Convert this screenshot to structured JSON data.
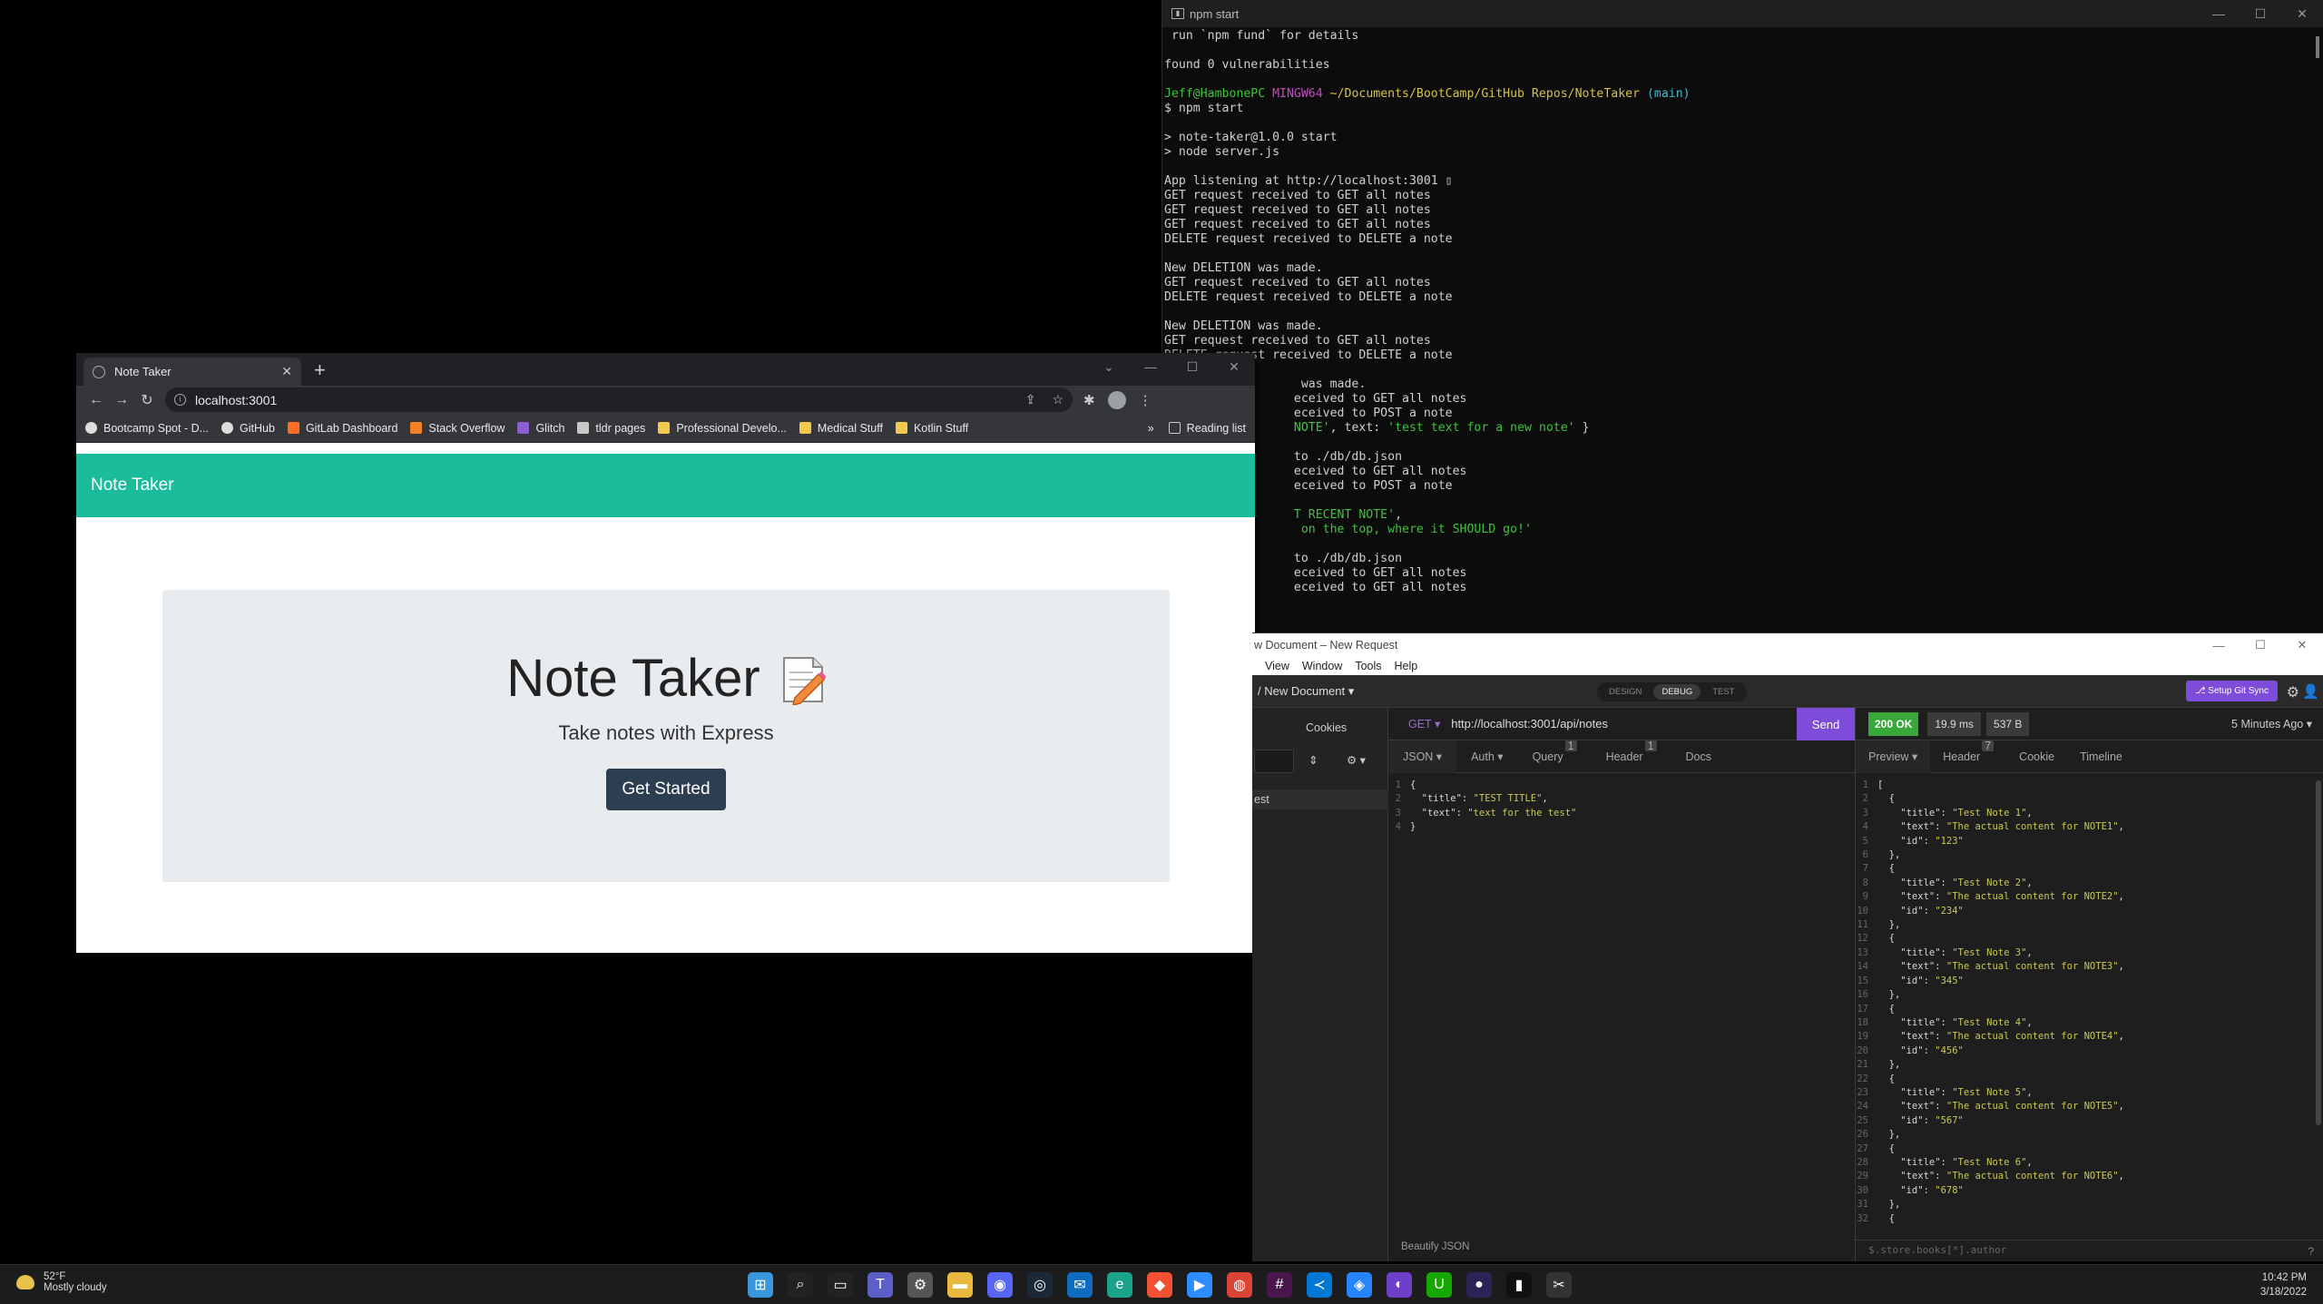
{
  "terminal": {
    "title": "npm start",
    "lines": [
      {
        "t": " run `npm fund` for details"
      },
      {
        "t": ""
      },
      {
        "t": "found 0 vulnerabilities"
      },
      {
        "t": ""
      },
      {
        "parts": [
          {
            "t": "Jeff@HambonePC ",
            "c": "g"
          },
          {
            "t": "MINGW64 ",
            "c": "m"
          },
          {
            "t": "~/Documents/BootCamp/GitHub Repos/NoteTaker ",
            "c": "y"
          },
          {
            "t": "(main)",
            "c": "c"
          }
        ]
      },
      {
        "t": "$ npm start"
      },
      {
        "t": ""
      },
      {
        "t": "> note-taker@1.0.0 start"
      },
      {
        "t": "> node server.js"
      },
      {
        "t": ""
      },
      {
        "t": "App listening at http://localhost:3001 ▯"
      },
      {
        "t": "GET request received to GET all notes"
      },
      {
        "t": "GET request received to GET all notes"
      },
      {
        "t": "GET request received to GET all notes"
      },
      {
        "t": "DELETE request received to DELETE a note"
      },
      {
        "t": ""
      },
      {
        "t": "New DELETION was made."
      },
      {
        "t": "GET request received to GET all notes"
      },
      {
        "t": "DELETE request received to DELETE a note"
      },
      {
        "t": ""
      },
      {
        "t": "New DELETION was made."
      },
      {
        "t": "GET request received to GET all notes"
      },
      {
        "t": "DELETE request received to DELETE a note"
      },
      {
        "t": ""
      },
      {
        "t": "                   was made."
      },
      {
        "t": "                  eceived to GET all notes"
      },
      {
        "t": "                  eceived to POST a note"
      },
      {
        "parts": [
          {
            "t": "                  NOTE'",
            "c": "g"
          },
          {
            "t": ", text: "
          },
          {
            "t": "'test text for a new note'",
            "c": "g"
          },
          {
            "t": " }"
          }
        ]
      },
      {
        "t": ""
      },
      {
        "t": "                  to ./db/db.json"
      },
      {
        "t": "                  eceived to GET all notes"
      },
      {
        "t": "                  eceived to POST a note"
      },
      {
        "t": ""
      },
      {
        "parts": [
          {
            "t": "                  T RECENT NOTE'",
            "c": "g"
          },
          {
            "t": ","
          }
        ]
      },
      {
        "parts": [
          {
            "t": "                   on the top, where it SHOULD go!'",
            "c": "g"
          }
        ]
      },
      {
        "t": ""
      },
      {
        "t": "                  to ./db/db.json"
      },
      {
        "t": "                  eceived to GET all notes"
      },
      {
        "t": "                  eceived to GET all notes"
      }
    ]
  },
  "chrome": {
    "tab_title": "Note Taker",
    "url": "localhost:3001",
    "bookmarks": [
      {
        "label": "Bootcamp Spot - D...",
        "icon": "circle"
      },
      {
        "label": "GitHub",
        "icon": "github"
      },
      {
        "label": "GitLab Dashboard",
        "icon": "gitlab"
      },
      {
        "label": "Stack Overflow",
        "icon": "stackoverflow"
      },
      {
        "label": "Glitch",
        "icon": "glitch"
      },
      {
        "label": "tldr pages",
        "icon": "tldr"
      },
      {
        "label": "Professional Develo...",
        "icon": "folder"
      },
      {
        "label": "Medical Stuff",
        "icon": "folder"
      },
      {
        "label": "Kotlin Stuff",
        "icon": "folder"
      }
    ],
    "reading_list": "Reading list",
    "more_bookmarks": "»"
  },
  "app": {
    "brand": "Note Taker",
    "heading": "Note Taker",
    "subtitle": "Take notes with Express",
    "cta": "Get Started",
    "colors": {
      "navbar": "#1abc9c",
      "button": "#2c3e50",
      "jumbotron": "#e9ecef"
    }
  },
  "insomnia": {
    "title": "w Document – New Request",
    "menu": [
      "View",
      "Window",
      "Tools",
      "Help"
    ],
    "document": "/ New Document ▾",
    "modes": [
      "DESIGN",
      "DEBUG",
      "TEST"
    ],
    "active_mode": "DEBUG",
    "sync_button": "⎇ Setup Git Sync",
    "sidebar": {
      "cookies": "Cookies",
      "request_label": "est"
    },
    "request": {
      "method": "GET ▾",
      "url": "http://localhost:3001/api/notes",
      "send": "Send",
      "tabs": [
        {
          "label": "JSON ▾",
          "badge": ""
        },
        {
          "label": "Auth ▾",
          "badge": ""
        },
        {
          "label": "Query",
          "badge": "1"
        },
        {
          "label": "Header",
          "badge": "1"
        },
        {
          "label": "Docs",
          "badge": ""
        }
      ],
      "body_lines": [
        {
          "n": "1",
          "code": [
            {
              "t": "{",
              "c": "p"
            }
          ]
        },
        {
          "n": "2",
          "code": [
            {
              "t": "  \"title\"",
              "c": "k"
            },
            {
              "t": ": ",
              "c": "p"
            },
            {
              "t": "\"TEST TITLE\"",
              "c": "s"
            },
            {
              "t": ",",
              "c": "p"
            }
          ]
        },
        {
          "n": "3",
          "code": [
            {
              "t": "  \"text\"",
              "c": "k"
            },
            {
              "t": ": ",
              "c": "p"
            },
            {
              "t": "\"text for the test\"",
              "c": "s"
            }
          ]
        },
        {
          "n": "4",
          "code": [
            {
              "t": "}",
              "c": "p"
            }
          ]
        }
      ],
      "beautify": "Beautify JSON"
    },
    "response": {
      "status": "200 OK",
      "time": "19.9 ms",
      "size": "537 B",
      "age": "5 Minutes Ago ▾",
      "tabs": [
        {
          "label": "Preview ▾",
          "badge": ""
        },
        {
          "label": "Header",
          "badge": "7"
        },
        {
          "label": "Cookie",
          "badge": ""
        },
        {
          "label": "Timeline",
          "badge": ""
        }
      ],
      "filter_placeholder": "$.store.books[*].author",
      "help": "?",
      "notes": [
        {
          "title": "Test Note 1",
          "text": "The actual content for NOTE1",
          "id": "123"
        },
        {
          "title": "Test Note 2",
          "text": "The actual content for NOTE2",
          "id": "234"
        },
        {
          "title": "Test Note 3",
          "text": "The actual content for NOTE3",
          "id": "345"
        },
        {
          "title": "Test Note 4",
          "text": "The actual content for NOTE4",
          "id": "456"
        },
        {
          "title": "Test Note 5",
          "text": "The actual content for NOTE5",
          "id": "567"
        },
        {
          "title": "Test Note 6",
          "text": "The actual content for NOTE6",
          "id": "678"
        }
      ]
    }
  },
  "taskbar": {
    "temp": "52°F",
    "condition": "Mostly cloudy",
    "time": "10:42 PM",
    "date": "3/18/2022",
    "apps": [
      "start-icon",
      "search-icon",
      "task-view-icon",
      "teams-icon",
      "settings-icon",
      "file-explorer-icon",
      "discord-icon",
      "steam-icon",
      "mail-icon",
      "edge-icon",
      "git-gui-icon",
      "zoom-icon",
      "chrome-icon",
      "slack-icon",
      "vscode-icon",
      "sourcetree-icon",
      "github-desktop-icon",
      "upwork-icon",
      "eclipse-icon",
      "terminal-icon",
      "snipping-tool-icon"
    ]
  }
}
